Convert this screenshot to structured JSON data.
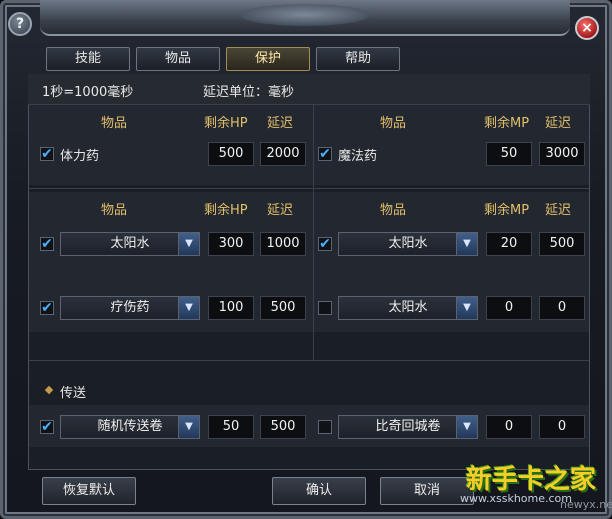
{
  "window": {
    "help_glyph": "?",
    "close_glyph": "×"
  },
  "tabs": [
    {
      "label": "技能"
    },
    {
      "label": "物品"
    },
    {
      "label": "保护",
      "active": true
    },
    {
      "label": "帮助"
    }
  ],
  "info": {
    "time_note": "1秒=1000毫秒",
    "unit_note": "延迟单位：毫秒"
  },
  "headers": {
    "item": "物品",
    "hp": "剩余HP",
    "mp": "剩余MP",
    "delay": "延迟"
  },
  "rows": {
    "hp_fixed": {
      "checked": true,
      "item": "体力药",
      "value": "500",
      "delay": "2000"
    },
    "mp_fixed": {
      "checked": true,
      "item": "魔法药",
      "value": "50",
      "delay": "3000"
    },
    "hp_sel1": {
      "checked": true,
      "item": "太阳水",
      "value": "300",
      "delay": "1000"
    },
    "mp_sel1": {
      "checked": true,
      "item": "太阳水",
      "value": "20",
      "delay": "500"
    },
    "hp_sel2": {
      "checked": true,
      "item": "疗伤药",
      "value": "100",
      "delay": "500"
    },
    "mp_sel2": {
      "checked": false,
      "item": "太阳水",
      "value": "0",
      "delay": "0"
    }
  },
  "teleport": {
    "title": "传送",
    "left": {
      "checked": true,
      "item": "随机传送卷",
      "value": "50",
      "delay": "500"
    },
    "right": {
      "checked": false,
      "item": "比奇回城卷",
      "value": "0",
      "delay": "0"
    }
  },
  "buttons": {
    "restore": "恢复默认",
    "confirm": "确认",
    "cancel": "取消"
  },
  "checkmark": "✔",
  "dropdown_arrow": "▼",
  "watermark": {
    "brand": "新手卡之家",
    "url": "www.xsskhome.com",
    "corner": "newyx.net"
  }
}
